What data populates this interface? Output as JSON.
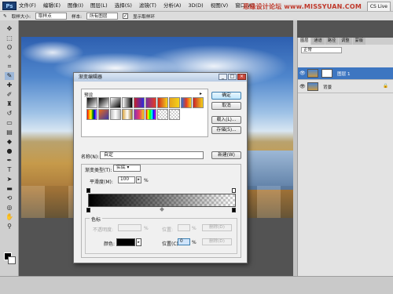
{
  "app": {
    "logo": "Ps",
    "watermark": "思缘设计论坛 www.MISSYUAN.COM",
    "cs_live": "CS Live"
  },
  "menu": [
    "文件(F)",
    "编辑(E)",
    "图像(I)",
    "图层(L)",
    "选择(S)",
    "滤镜(T)",
    "分析(A)",
    "3D(D)",
    "视图(V)",
    "窗口(W)"
  ],
  "options": {
    "sample_size_label": "取样大小:",
    "sample_size_value": "取样点",
    "sample_label": "样本:",
    "sample_value": "所有图层",
    "show_ring_label": "显示取样环",
    "show_ring_checked": true
  },
  "dialog": {
    "title": "渐变编辑器",
    "presets_label": "预设",
    "buttons": {
      "ok": "确定",
      "cancel": "取消",
      "load": "载入(L)...",
      "save": "存储(S)...",
      "new": "新建(W)"
    },
    "name_label": "名称(N):",
    "name_value": "自定",
    "gradient_type_label": "渐变类型(T):",
    "gradient_type_value": "实底",
    "smoothness_label": "平滑度(M):",
    "smoothness_value": "100",
    "percent": "%",
    "stops": {
      "group_label": "色标",
      "opacity_label": "不透明度:",
      "location_label": "位置:",
      "delete_label": "删除(D)",
      "color_label": "颜色:",
      "color_location_label": "位置(C):",
      "color_location_value": "0",
      "color_value": "#000000"
    },
    "gradient": {
      "from": "#000000",
      "to": "transparent"
    },
    "presets": [
      "#000000",
      "#555555",
      "#e8e8e8",
      "#c8202a",
      "#d2281c",
      "#7a2fa0",
      "#e63b20",
      "#e6a31c",
      "#f4d21a",
      "#2b6fd6",
      "#e86a1a",
      "#3a3aa8",
      "#c0c0c0",
      "#b0b0b0",
      "#8d2fb3",
      "#e53a6a",
      "#f0f0f0",
      "#c8c8c8"
    ]
  },
  "layers": {
    "tabs": [
      "图层",
      "通道",
      "路径",
      "调整",
      "蒙版"
    ],
    "blend_mode": "正常",
    "items": [
      {
        "name": "图层 1",
        "selected": true
      },
      {
        "name": "背景",
        "selected": false
      }
    ]
  }
}
